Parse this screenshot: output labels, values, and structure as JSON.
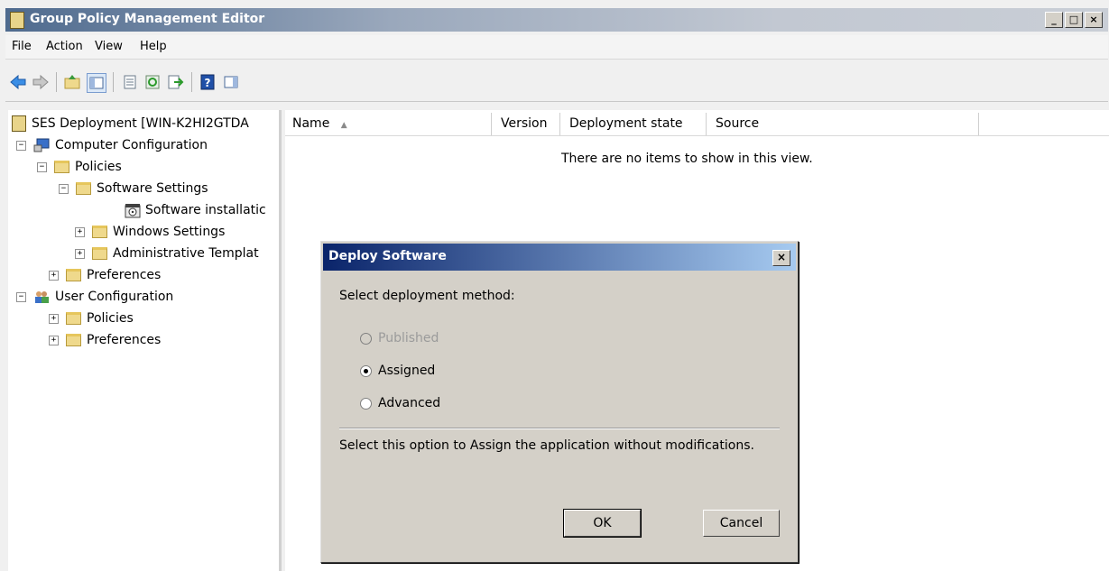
{
  "window": {
    "title": "Group Policy Management Editor",
    "controls": [
      "_",
      "□",
      "×"
    ]
  },
  "menu": [
    "File",
    "Action",
    "View",
    "Help"
  ],
  "toolbar": {
    "buttons": [
      "back-icon",
      "forward-icon",
      "up-folder-icon",
      "show-hide-tree-icon",
      "properties-icon",
      "refresh-icon",
      "export-list-icon",
      "help-icon",
      "show-hide-action-pane-icon"
    ]
  },
  "tree": {
    "root": "SES Deployment [WIN-K2HI2GTDA",
    "items": [
      {
        "label": "Computer Configuration",
        "expander": "−"
      },
      {
        "label": "Policies",
        "expander": "−"
      },
      {
        "label": "Software Settings",
        "expander": "−"
      },
      {
        "label": "Software installatic",
        "expander": ""
      },
      {
        "label": "Windows Settings",
        "expander": "+"
      },
      {
        "label": "Administrative Templat",
        "expander": "+"
      },
      {
        "label": "Preferences",
        "expander": "+"
      },
      {
        "label": "User Configuration",
        "expander": "−"
      },
      {
        "label": "Policies",
        "expander": "+"
      },
      {
        "label": "Preferences",
        "expander": "+"
      }
    ]
  },
  "list": {
    "columns": [
      "Name",
      "Version",
      "Deployment state",
      "Source"
    ],
    "sort_indicator": "▲",
    "empty_message": "There are no items to show in this view."
  },
  "dialog": {
    "title": "Deploy Software",
    "close_label": "×",
    "prompt": "Select deployment method:",
    "options": [
      {
        "label": "Published",
        "checked": false,
        "disabled": true
      },
      {
        "label": "Assigned",
        "checked": true,
        "disabled": false
      },
      {
        "label": "Advanced",
        "checked": false,
        "disabled": false
      }
    ],
    "description": "Select this option to Assign the application without modifications.",
    "ok_label": "OK",
    "cancel_label": "Cancel"
  }
}
